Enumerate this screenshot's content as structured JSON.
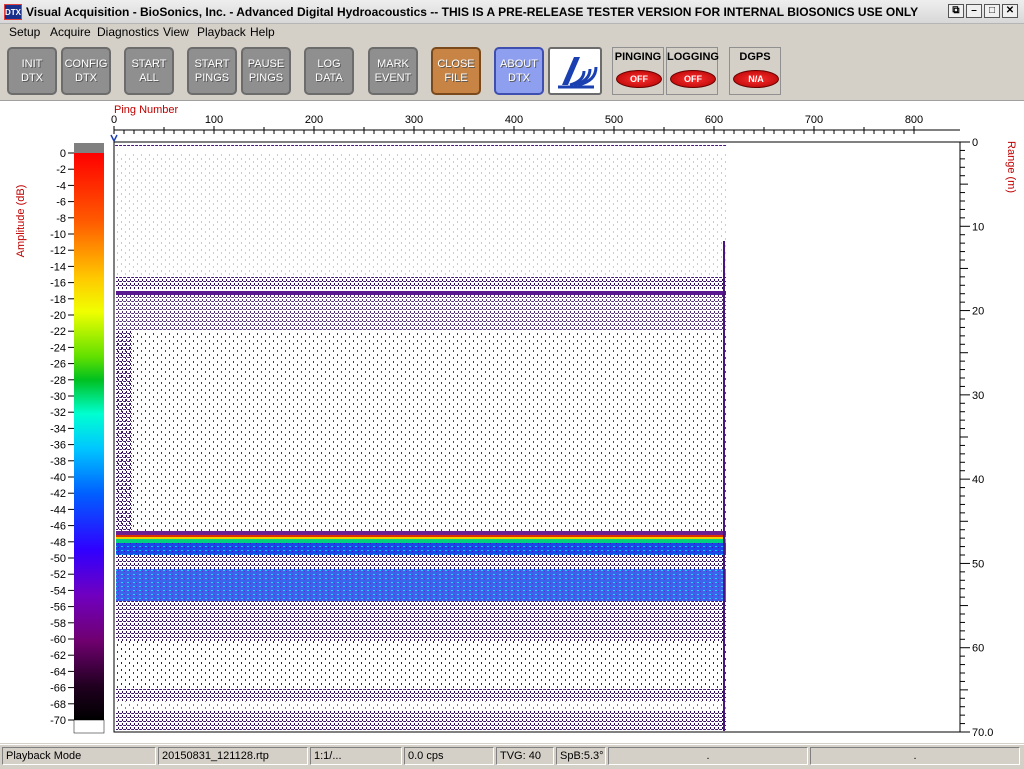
{
  "window": {
    "title": "Visual Acquisition  -  BioSonics, Inc.  -  Advanced Digital Hydroacoustics  -- THIS IS A PRE-RELEASE TESTER VERSION FOR INTERNAL BIOSONICS USE ONLY",
    "icon_text": "DTX",
    "restore_glyph": "⧉",
    "minimize_glyph": "–",
    "maximize_glyph": "□",
    "close_glyph": "✕"
  },
  "menu": [
    "Setup",
    "Acquire",
    "Diagnostics",
    "View",
    "Playback",
    "Help"
  ],
  "toolbar": {
    "buttons": [
      {
        "label": "INIT\nDTX",
        "style": "gray"
      },
      {
        "label": "CONFIG\nDTX",
        "style": "gray"
      },
      {
        "label": "START\nALL",
        "style": "gray"
      },
      {
        "label": "START\nPINGS",
        "style": "gray"
      },
      {
        "label": "PAUSE\nPINGS",
        "style": "gray"
      },
      {
        "label": "LOG\nDATA",
        "style": "gray"
      },
      {
        "label": "MARK\nEVENT",
        "style": "gray"
      },
      {
        "label": "CLOSE\nFILE",
        "style": "orange"
      },
      {
        "label": "ABOUT\nDTX",
        "style": "blue"
      }
    ],
    "logo_icon": "biosonics-logo-icon",
    "indicators": [
      {
        "label": "PINGING",
        "state": "OFF"
      },
      {
        "label": "LOGGING",
        "state": "OFF"
      },
      {
        "label": "DGPS",
        "state": "N/A"
      }
    ],
    "indicator_color": "#d00000"
  },
  "echogram": {
    "top_axis_title": "Ping Number",
    "left_axis_title": "Amplitude (dB)",
    "right_axis_title": "Range (m)",
    "ping_ticks": [
      "0",
      "100",
      "200",
      "300",
      "400",
      "500",
      "600",
      "700",
      "800"
    ],
    "range_ticks": [
      "0",
      "10",
      "20",
      "30",
      "40",
      "50",
      "60",
      "70.0"
    ],
    "amplitude_ticks": [
      "0",
      "-2",
      "-4",
      "-6",
      "-8",
      "-10",
      "-12",
      "-14",
      "-16",
      "-18",
      "-20",
      "-22",
      "-24",
      "-26",
      "-28",
      "-30",
      "-32",
      "-34",
      "-36",
      "-38",
      "-40",
      "-42",
      "-44",
      "-46",
      "-48",
      "-50",
      "-52",
      "-54",
      "-56",
      "-58",
      "-60",
      "-62",
      "-64",
      "-66",
      "-68",
      "-70"
    ],
    "ping_range": [
      0,
      850
    ],
    "range_m": [
      0,
      70
    ],
    "amplitude_db": [
      0,
      -70
    ],
    "pings_recorded": 612,
    "colormap": [
      "#ff0000",
      "#ff6000",
      "#ffa000",
      "#ffe000",
      "#b0ff00",
      "#00d000",
      "#00ffb0",
      "#00e0ff",
      "#00a0ff",
      "#0040ff",
      "#4000ff",
      "#8000c0",
      "#800080",
      "#400040",
      "#000000"
    ]
  },
  "statusbar": {
    "mode": "Playback Mode",
    "file": "20150831_121128.rtp",
    "ratio": "1:1/...",
    "cps": "0.0 cps",
    "tvg": "TVG: 40",
    "spb": "SpB:5.3°",
    "extra1": ".",
    "extra2": "."
  }
}
